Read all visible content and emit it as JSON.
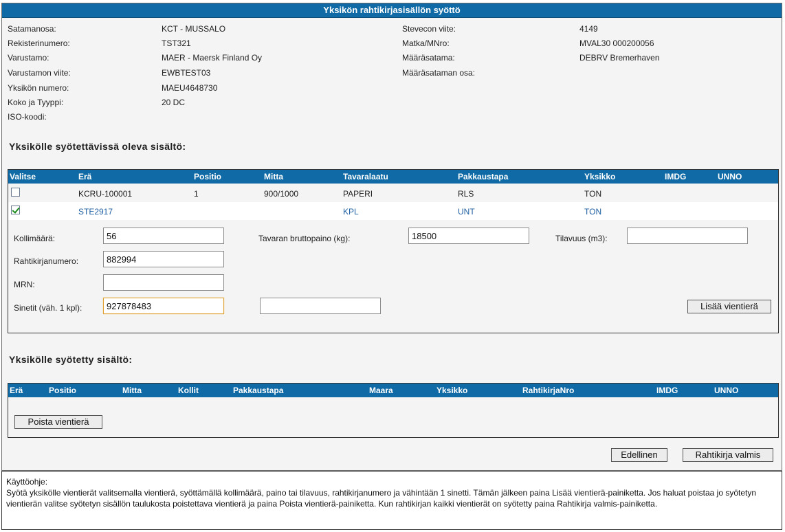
{
  "window": {
    "title": "Yksikön rahtikirjasisällön syöttö"
  },
  "info_left": [
    {
      "label": "Satamanosa:",
      "value": "KCT - MUSSALO"
    },
    {
      "label": "Rekisterinumero:",
      "value": "TST321"
    },
    {
      "label": "Varustamo:",
      "value": "MAER - Maersk Finland Oy"
    },
    {
      "label": "Varustamon viite:",
      "value": "EWBTEST03"
    },
    {
      "label": "Yksikön numero:",
      "value": "MAEU4648730"
    },
    {
      "label": "Koko ja Tyyppi:",
      "value": "20 DC"
    },
    {
      "label": "ISO-koodi:",
      "value": ""
    }
  ],
  "info_right": [
    {
      "label": "Stevecon viite:",
      "value": "4149"
    },
    {
      "label": "Matka/MNro:",
      "value": "MVAL30 000200056"
    },
    {
      "label": "Määräsatama:",
      "value": "DEBRV Bremerhaven"
    },
    {
      "label": "Määräsataman osa:",
      "value": ""
    }
  ],
  "available": {
    "title": "Yksikölle syötettävissä oleva sisältö:",
    "columns": [
      "Valitse",
      "Erä",
      "Positio",
      "Mitta",
      "Tavaralaatu",
      "Pakkaustapa",
      "Yksikko",
      "IMDG",
      "UNNO"
    ],
    "rows": [
      {
        "checked": false,
        "era": "KCRU-100001",
        "positio": "1",
        "mitta": "900/1000",
        "tavaralaatu": "PAPERI",
        "pakkaustapa": "RLS",
        "yksikko": "TON",
        "imdg": "",
        "unno": ""
      },
      {
        "checked": true,
        "era": "STE2917",
        "positio": "",
        "mitta": "",
        "tavaralaatu": "KPL",
        "pakkaustapa": "UNT",
        "yksikko": "TON",
        "imdg": "",
        "unno": ""
      }
    ]
  },
  "form": {
    "kollimaara": {
      "label": "Kollimäärä:",
      "value": "56"
    },
    "bruttopaino": {
      "label": "Tavaran bruttopaino (kg):",
      "value": "18500"
    },
    "tilavuus": {
      "label": "Tilavuus (m3):",
      "value": ""
    },
    "rahtikirjanumero": {
      "label": "Rahtikirjanumero:",
      "value": "882994"
    },
    "mrn": {
      "label": "MRN:",
      "value": ""
    },
    "sinetit": {
      "label": "Sinetit (väh. 1 kpl):",
      "value": "927878483",
      "value2": ""
    },
    "add_button": "Lisää vientierä"
  },
  "entered": {
    "title": "Yksikölle syötetty sisältö:",
    "columns": [
      "Erä",
      "Positio",
      "Mitta",
      "Kollit",
      "Pakkaustapa",
      "Maara",
      "Yksikko",
      "RahtikirjaNro",
      "IMDG",
      "UNNO"
    ],
    "remove_button": "Poista vientierä"
  },
  "nav": {
    "previous": "Edellinen",
    "done": "Rahtikirja valmis"
  },
  "help": {
    "title": "Käyttöohje:",
    "text": "Syötä yksikölle vientierät valitsemalla vientierä, syöttämällä kollimäärä, paino tai tilavuus, rahtikirjanumero ja vähintään 1 sinetti. Tämän jälkeen paina Lisää vientierä-painiketta. Jos haluat poistaa jo syötetyn vientierän valitse syötetyn sisällön taulukosta poistettava vientierä ja paina Poista vientierä-painiketta. Kun rahtikirjan kaikki vientierät on syötetty paina Rahtikirja valmis-painiketta."
  },
  "colors": {
    "header_blue": "#0f6aa5",
    "selected_text": "#1f5fa3",
    "focus_border": "#e0a030"
  }
}
